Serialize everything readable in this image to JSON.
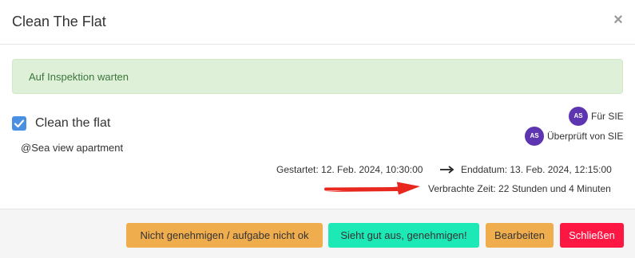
{
  "modal": {
    "title": "Clean The Flat",
    "close_glyph": "×"
  },
  "alert": {
    "text": "Auf Inspektion warten",
    "color": "#3c763d",
    "background": "#dff0d8"
  },
  "task": {
    "checked": true,
    "name": "Clean the flat",
    "location": "@Sea view apartment"
  },
  "assignees": [
    {
      "initials": "AS",
      "label": "Für SIE"
    },
    {
      "initials": "AS",
      "label": "Überprüft von SIE"
    }
  ],
  "times": {
    "started": "Gestartet: 12. Feb. 2024, 10:30:00",
    "ended": "Enddatum: 13. Feb. 2024, 12:15:00",
    "spent": "Verbrachte Zeit: 22 Stunden und 4 Minuten"
  },
  "footer": {
    "reject_label": "Nicht genehmigen / aufgabe nicht ok",
    "approve_label": "Sieht gut aus, genehmigen!",
    "edit_label": "Bearbeiten",
    "close_label": "Schließen"
  },
  "colors": {
    "avatar": "#5e35b1",
    "checkbox": "#4a90e2",
    "warning": "#f0ad4e",
    "approve": "#1de9b6",
    "danger": "#ff1744",
    "annotation_arrow": "#e8281e"
  },
  "icons": {
    "close": "close-icon",
    "check": "check-icon",
    "arrow": "arrow-right-icon",
    "annotation": "red-arrow-icon"
  }
}
